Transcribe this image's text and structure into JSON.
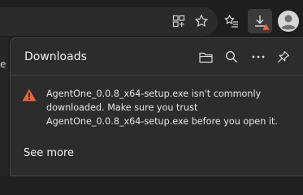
{
  "toolbar": {
    "icons": [
      "extensions-icon",
      "favorite-star-icon",
      "favorites-list-icon",
      "downloads-icon",
      "profile-avatar-icon"
    ],
    "downloads_badge_color": "#e5683b"
  },
  "sidebar": {
    "partial_letter": "e"
  },
  "downloads": {
    "title": "Downloads",
    "header_icons": [
      "open-folder-icon",
      "search-icon",
      "more-options-icon",
      "pin-icon"
    ],
    "warning": {
      "icon_color": "#e5683b",
      "message": "AgentOne_0.0.8_x64-setup.exe isn't commonly downloaded. Make sure you trust AgentOne_0.0.8_x64-setup.exe before you open it."
    },
    "see_more_label": "See more"
  },
  "colors": {
    "panel_bg": "#2c2c2c",
    "toolbar_bg": "#1e1e1e",
    "text": "#f0f0f0",
    "warning": "#e5683b"
  }
}
